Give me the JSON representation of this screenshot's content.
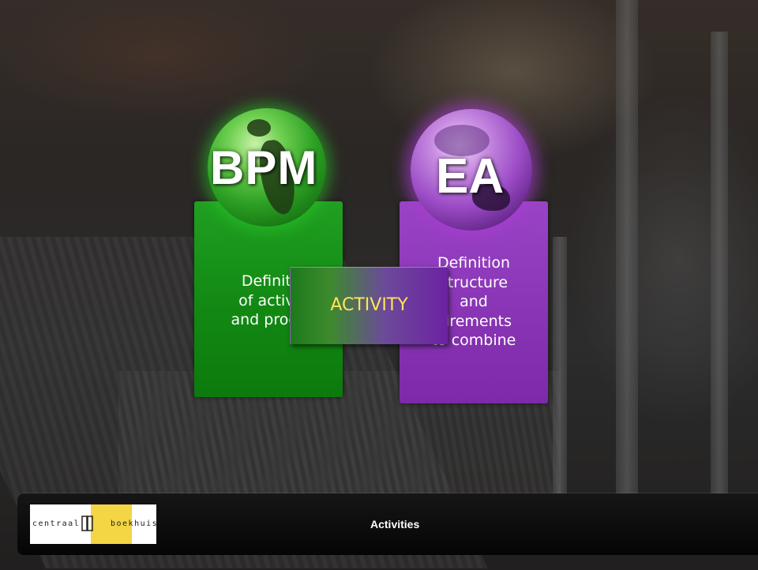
{
  "slide": {
    "bpm": {
      "title": "BPM",
      "text": "Definiti\nof activi\nand proce"
    },
    "ea": {
      "title": "EA",
      "text": "Definition\nstructure\nand\nuirements\nto combine"
    },
    "activity": {
      "label": "ACTIVITY"
    },
    "colors": {
      "bpm": "#138a14",
      "ea": "#8a36b6",
      "activity_text": "#ffe45a"
    }
  },
  "footer": {
    "logo": {
      "left_text": "centraal",
      "right_text": "boekhuis",
      "icon": "book-icon"
    },
    "title": "Activities"
  }
}
